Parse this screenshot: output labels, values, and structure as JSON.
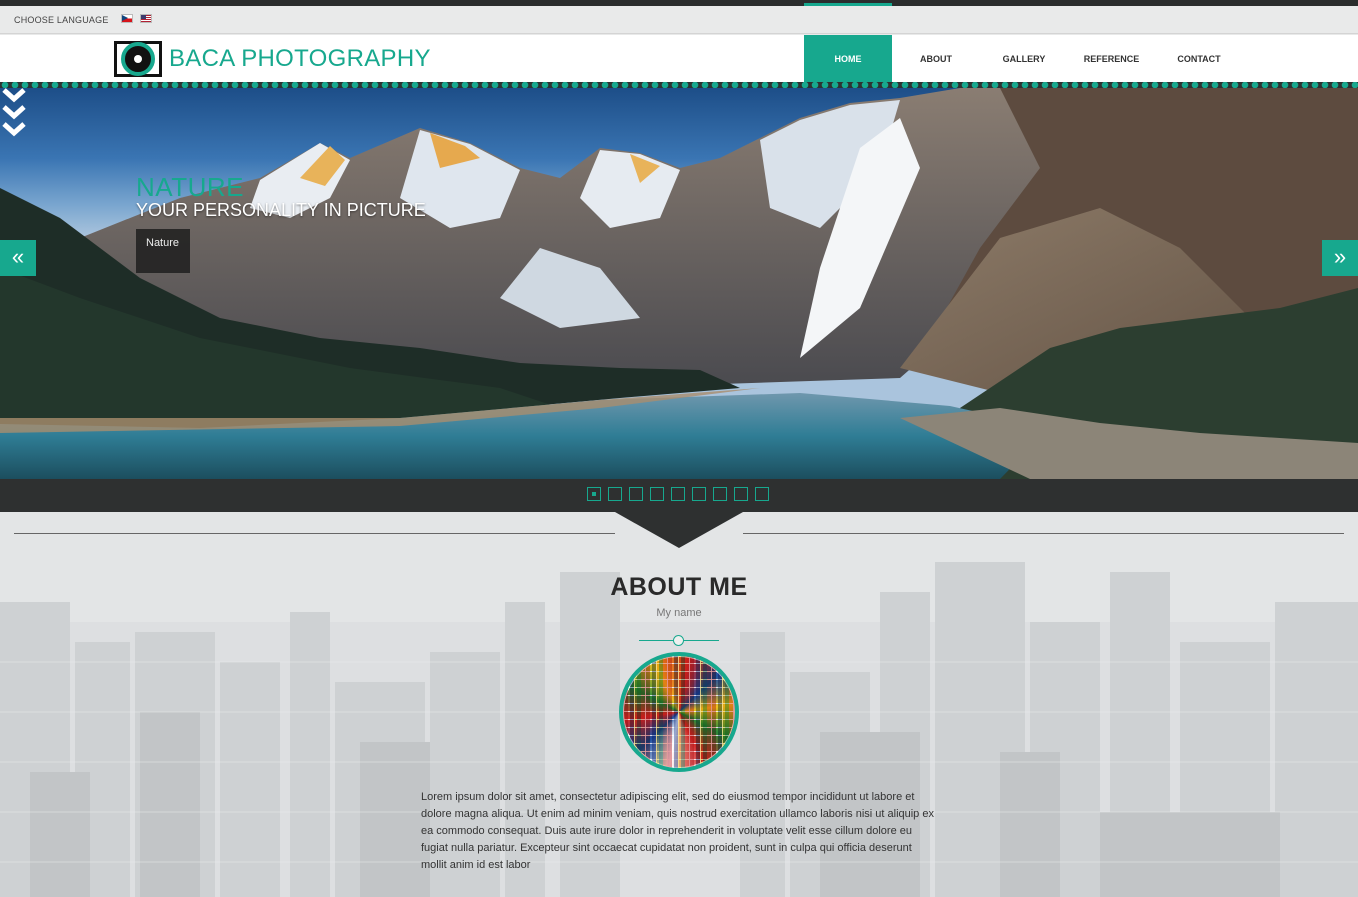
{
  "topbar": {
    "language_label": "CHOOSE LANGUAGE",
    "flags": [
      {
        "name": "czech-flag",
        "lang": "cs"
      },
      {
        "name": "us-flag",
        "lang": "en"
      }
    ]
  },
  "header": {
    "brand": "BACA PHOTOGRAPHY",
    "logo_icon": "camera-lens-icon",
    "nav": [
      {
        "label": "HOME",
        "active": true
      },
      {
        "label": "ABOUT",
        "active": false
      },
      {
        "label": "GALLERY",
        "active": false
      },
      {
        "label": "REFERENCE",
        "active": false
      },
      {
        "label": "CONTACT",
        "active": false
      }
    ]
  },
  "hero": {
    "title": "NATURE",
    "subtitle": "YOUR PERSONALITY IN PICTURE",
    "button_label": "Nature",
    "prev_icon": "double-chevron-left-icon",
    "next_icon": "double-chevron-right-icon",
    "scroll_icon": "triple-chevron-down-icon",
    "prev_glyph": "«",
    "next_glyph": "»"
  },
  "slider": {
    "slide_count": 9,
    "active_index": 0
  },
  "about": {
    "title": "ABOUT ME",
    "subtitle": "My name",
    "body": "Lorem ipsum dolor sit amet, consectetur adipiscing elit, sed do eiusmod tempor incididunt ut labore et dolore magna aliqua. Ut enim ad minim veniam, quis nostrud exercitation ullamco laboris nisi ut aliquip ex ea commodo consequat. Duis aute irure dolor in reprehenderit in voluptate velit esse cillum dolore eu fugiat nulla pariatur. Excepteur sint occaecat cupidatat non proident, sunt in culpa qui officia deserunt mollit anim id est labor"
  },
  "colors": {
    "accent": "#17a88e",
    "dark": "#2e3030",
    "text": "#333333"
  }
}
